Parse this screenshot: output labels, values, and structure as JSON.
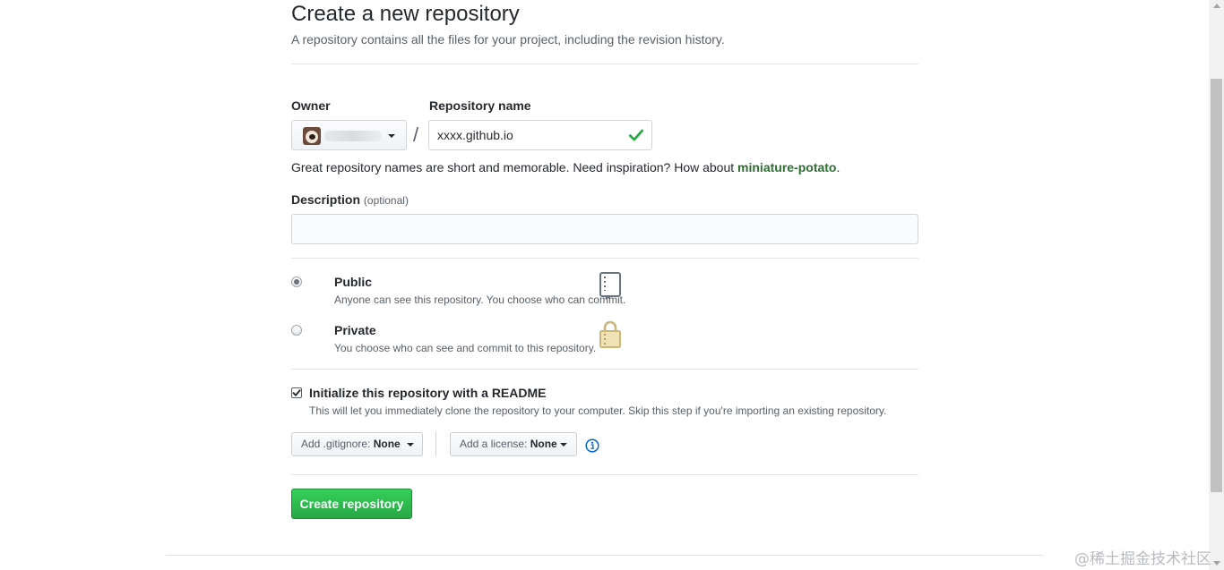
{
  "page": {
    "title": "Create a new repository",
    "subtitle": "A repository contains all the files for your project, including the revision history."
  },
  "owner": {
    "label": "Owner"
  },
  "repo": {
    "label": "Repository name",
    "separator": "/",
    "value": "xxxx.github.io",
    "hint_prefix": "Great repository names are short and memorable. Need inspiration? How about ",
    "suggestion": "miniature-potato",
    "hint_suffix": "."
  },
  "description": {
    "label": "Description",
    "optional": "(optional)",
    "value": ""
  },
  "visibility": {
    "selected": "public",
    "public": {
      "title": "Public",
      "note": "Anyone can see this repository. You choose who can commit."
    },
    "private": {
      "title": "Private",
      "note": "You choose who can see and commit to this repository."
    }
  },
  "readme": {
    "checked": true,
    "label": "Initialize this repository with a README",
    "note": "This will let you immediately clone the repository to your computer. Skip this step if you're importing an existing repository."
  },
  "gitignore": {
    "prefix": "Add .gitignore:",
    "value": "None"
  },
  "license": {
    "prefix": "Add a license:",
    "value": "None"
  },
  "create_button": "Create repository",
  "watermark": "@稀土掘金技术社区",
  "colors": {
    "accent_green": "#28a745",
    "suggestion_green": "#2c6e2f",
    "info_blue": "#0366d6"
  },
  "icons": [
    "check-icon",
    "repo-icon",
    "lock-icon",
    "info-icon",
    "caret-down-icon",
    "checkbox-check-icon"
  ]
}
